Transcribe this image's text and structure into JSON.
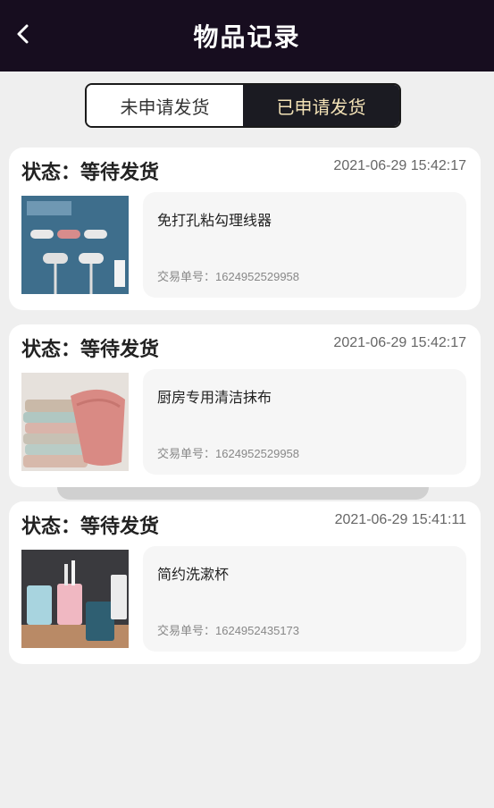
{
  "header": {
    "title": "物品记录"
  },
  "tabs": [
    {
      "label": "未申请发货",
      "active": false
    },
    {
      "label": "已申请发货",
      "active": true
    }
  ],
  "order_label": "交易单号：",
  "records": [
    {
      "status": "状态：等待发货",
      "time": "2021-06-29 15:42:17",
      "name": "免打孔粘勾理线器",
      "order": "1624952529958",
      "image": "cable-clip-product"
    },
    {
      "status": "状态：等待发货",
      "time": "2021-06-29 15:42:17",
      "name": "厨房专用清洁抹布",
      "order": "1624952529958",
      "image": "cleaning-cloth-stack"
    },
    {
      "status": "状态：等待发货",
      "time": "2021-06-29 15:41:11",
      "name": "简约洗漱杯",
      "order": "1624952435173",
      "image": "toothbrush-cups"
    }
  ],
  "colors": {
    "header_bg": "#170d1f",
    "active_tab_bg": "#1b1b22",
    "active_tab_text": "#f3e2b6",
    "page_bg": "#efefef"
  }
}
